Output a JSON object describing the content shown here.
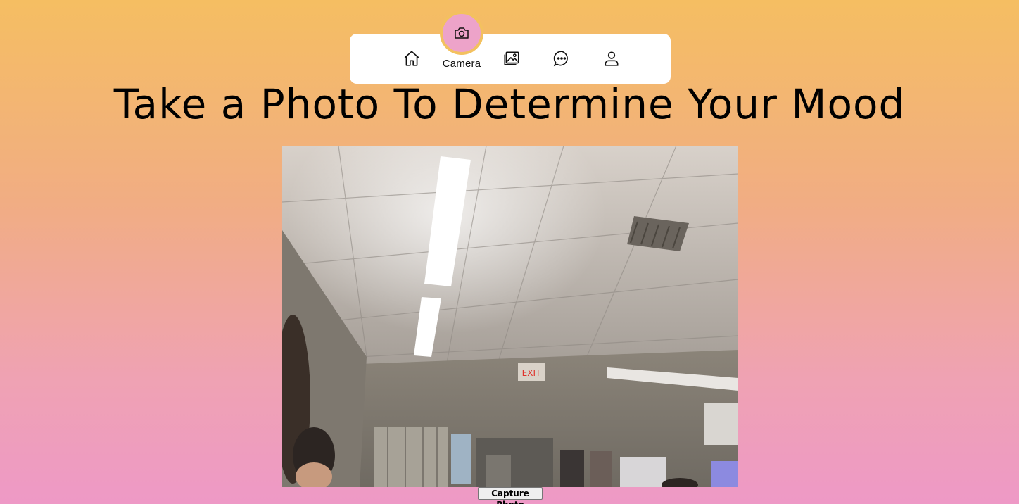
{
  "nav": {
    "items": [
      {
        "icon": "home-icon"
      },
      {
        "icon": "camera-icon",
        "label": "Camera",
        "active": true
      },
      {
        "icon": "gallery-icon"
      },
      {
        "icon": "chat-icon"
      },
      {
        "icon": "user-icon"
      }
    ],
    "active_label": "Camera"
  },
  "page": {
    "title": "Take a Photo To Determine Your Mood"
  },
  "camera": {
    "exit_sign": "EXIT",
    "capture_label": "Capture Photo"
  },
  "colors": {
    "gradient_top": "#f5be62",
    "gradient_bottom": "#ee99c6",
    "active_circle": "#eda3c9",
    "active_ring": "#f3c15f"
  }
}
